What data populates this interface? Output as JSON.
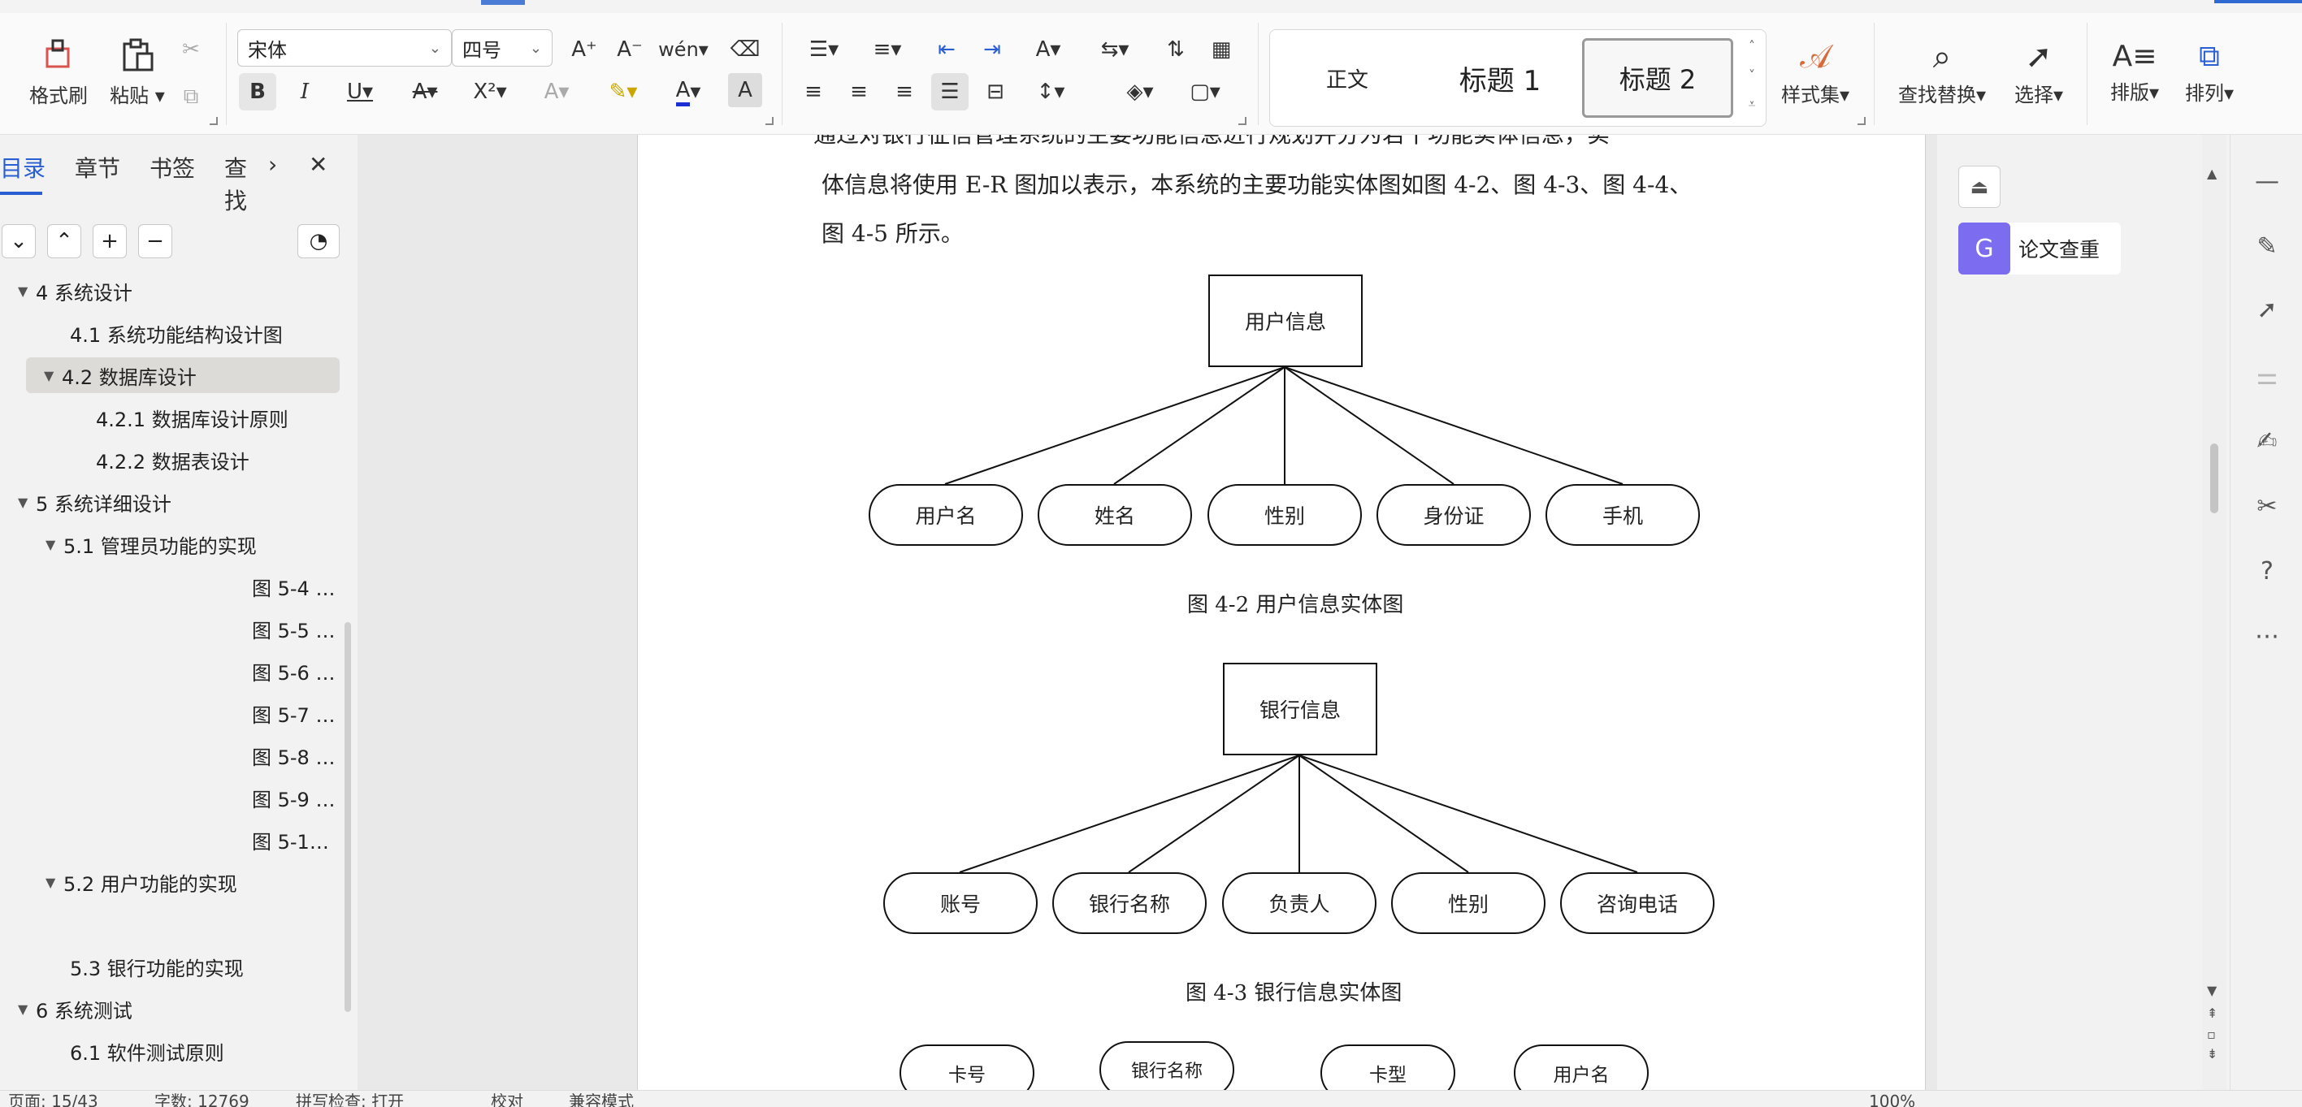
{
  "ribbon": {
    "format_painter": "格式刷",
    "paste": "粘贴",
    "font_name": "宋体",
    "font_size": "四号",
    "styles": {
      "normal": "正文",
      "h1": "标题  1",
      "h2": "标题  2"
    },
    "style_set": "样式集",
    "find_replace": "查找替换",
    "select": "选择",
    "layout": "排版",
    "arrange": "排列"
  },
  "left_panel": {
    "tabs": [
      "目录",
      "章节",
      "书签",
      "查找"
    ],
    "active_tab": "目录",
    "toc": [
      {
        "label": "4  系统设计",
        "level": 1,
        "expanded": true
      },
      {
        "label": "4.1 系统功能结构设计图",
        "level": 2
      },
      {
        "label": "4.2 数据库设计",
        "level": 2,
        "expanded": true,
        "selected": true
      },
      {
        "label": "4.2.1 数据库设计原则",
        "level": 3
      },
      {
        "label": "4.2.2    数据表设计",
        "level": 3
      },
      {
        "label": "5 系统详细设计",
        "level": 1,
        "expanded": true
      },
      {
        "label": "5.1  管理员功能的实现",
        "level": 2,
        "expanded": true
      },
      {
        "label": "图 5-4 …",
        "level": 9
      },
      {
        "label": "图 5-5 …",
        "level": 9
      },
      {
        "label": "图 5-6 …",
        "level": 9
      },
      {
        "label": "图 5-7 …",
        "level": 9
      },
      {
        "label": "图 5-8 …",
        "level": 9
      },
      {
        "label": "图 5-9 …",
        "level": 9
      },
      {
        "label": "图 5-1…",
        "level": 9
      },
      {
        "label": "5.2  用户功能的实现",
        "level": 2,
        "expanded": true
      },
      {
        "label": "",
        "level": 2
      },
      {
        "label": "5.3  银行功能的实现",
        "level": 2
      },
      {
        "label": "6  系统测试",
        "level": 1,
        "expanded": true
      },
      {
        "label": "6.1 软件测试原则",
        "level": 2
      }
    ]
  },
  "document": {
    "line1": "通过对银行征信管理系统的主要功能信息进行规划并分为若干功能实体信息，实",
    "line2": "体信息将使用 E-R 图加以表示，本系统的主要功能实体图如图 4-2、图 4-3、图 4-4、",
    "line3": "图 4-5 所示。",
    "fig1": {
      "entity": "用户信息",
      "attributes": [
        "用户名",
        "姓名",
        "性别",
        "身份证",
        "手机"
      ],
      "caption": "图 4-2 用户信息实体图"
    },
    "fig2": {
      "entity": "银行信息",
      "attributes": [
        "账号",
        "银行名称",
        "负责人",
        "性别",
        "咨询电话"
      ],
      "caption": "图 4-3 银行信息实体图"
    },
    "fig3": {
      "attributes": [
        "卡号",
        "银行名称",
        "卡型",
        "用户名"
      ]
    }
  },
  "right_panel": {
    "plagiarism_check": "论文查重"
  },
  "status_bar": {
    "page": "页面: 15/43",
    "words": "字数: 12769",
    "spell": "拼写检查: 打开",
    "proof": "校对",
    "compat": "兼容模式",
    "zoom": "100%"
  },
  "colors": {
    "accent": "#2a5ed3",
    "plagiarism_button": "#7b6cf0"
  }
}
